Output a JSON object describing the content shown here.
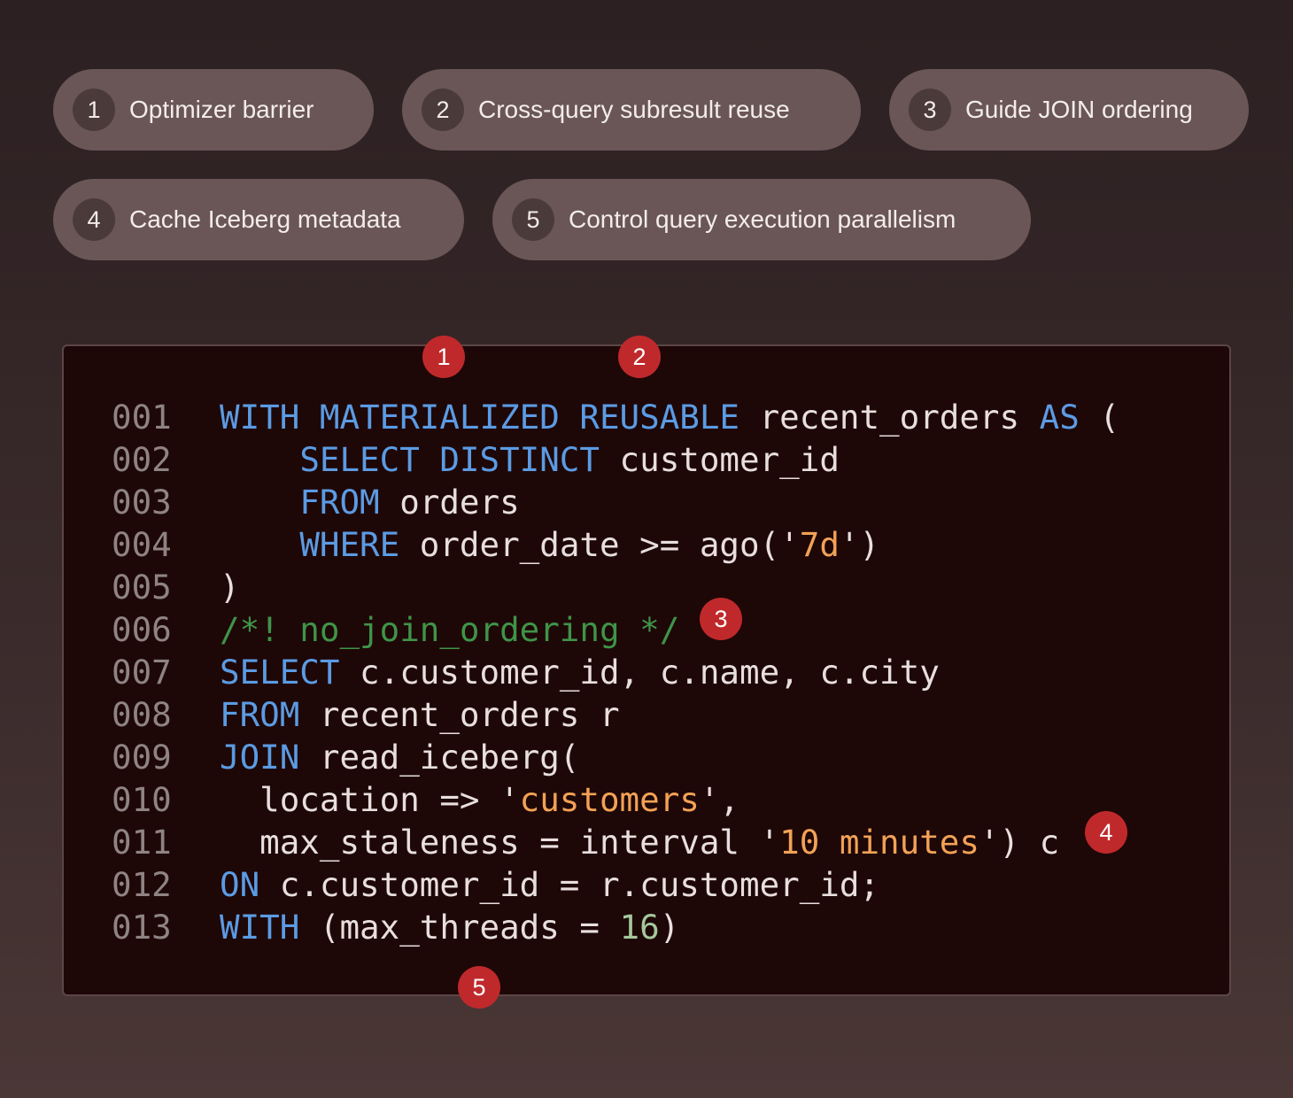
{
  "pills": [
    {
      "num": "1",
      "label": "Optimizer barrier"
    },
    {
      "num": "2",
      "label": "Cross-query subresult reuse"
    },
    {
      "num": "3",
      "label": "Guide JOIN ordering"
    },
    {
      "num": "4",
      "label": "Cache Iceberg metadata"
    },
    {
      "num": "5",
      "label": "Control query execution parallelism"
    }
  ],
  "markers": [
    "1",
    "2",
    "3",
    "4",
    "5"
  ],
  "code": {
    "line_numbers": [
      "001",
      "002",
      "003",
      "004",
      "005",
      "006",
      "007",
      "008",
      "009",
      "010",
      "011",
      "012",
      "013"
    ],
    "lines": [
      [
        {
          "t": "kw",
          "v": "WITH MATERIALIZED REUSABLE"
        },
        {
          "t": "tx",
          "v": " recent_orders "
        },
        {
          "t": "kw",
          "v": "AS"
        },
        {
          "t": "tx",
          "v": " ("
        }
      ],
      [
        {
          "t": "tx",
          "v": "    "
        },
        {
          "t": "kw",
          "v": "SELECT DISTINCT"
        },
        {
          "t": "tx",
          "v": " customer_id"
        }
      ],
      [
        {
          "t": "tx",
          "v": "    "
        },
        {
          "t": "kw",
          "v": "FROM"
        },
        {
          "t": "tx",
          "v": " orders"
        }
      ],
      [
        {
          "t": "tx",
          "v": "    "
        },
        {
          "t": "kw",
          "v": "WHERE"
        },
        {
          "t": "tx",
          "v": " order_date >= ago('"
        },
        {
          "t": "st",
          "v": "7d"
        },
        {
          "t": "tx",
          "v": "')"
        }
      ],
      [
        {
          "t": "tx",
          "v": ")"
        }
      ],
      [
        {
          "t": "cm",
          "v": "/*! no_join_ordering */"
        }
      ],
      [
        {
          "t": "kw",
          "v": "SELECT"
        },
        {
          "t": "tx",
          "v": " c.customer_id, c.name, c.city"
        }
      ],
      [
        {
          "t": "kw",
          "v": "FROM"
        },
        {
          "t": "tx",
          "v": " recent_orders r"
        }
      ],
      [
        {
          "t": "kw",
          "v": "JOIN"
        },
        {
          "t": "tx",
          "v": " read_iceberg("
        }
      ],
      [
        {
          "t": "tx",
          "v": "  location => '"
        },
        {
          "t": "st",
          "v": "customers"
        },
        {
          "t": "tx",
          "v": "',"
        }
      ],
      [
        {
          "t": "tx",
          "v": "  max_staleness = interval '"
        },
        {
          "t": "st",
          "v": "10 minutes"
        },
        {
          "t": "tx",
          "v": "') c"
        }
      ],
      [
        {
          "t": "kw",
          "v": "ON"
        },
        {
          "t": "tx",
          "v": " c.customer_id = r.customer_id;"
        }
      ],
      [
        {
          "t": "kw",
          "v": "WITH"
        },
        {
          "t": "tx",
          "v": " (max_threads = "
        },
        {
          "t": "nm",
          "v": "16"
        },
        {
          "t": "tx",
          "v": ")"
        }
      ]
    ]
  }
}
